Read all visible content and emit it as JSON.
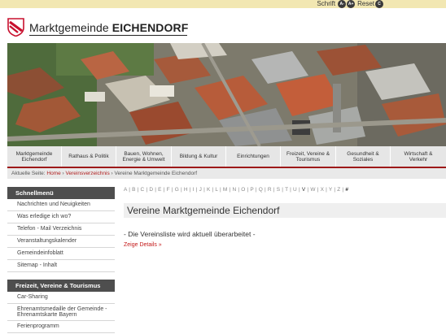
{
  "topbar": {
    "font_label": "Schrift",
    "font_decrease": "A-",
    "font_increase": "A+",
    "reset_label": "Reset",
    "reset_icon": "C"
  },
  "header": {
    "title_bold": "Marktgemeinde",
    "title_rest": "EICHENDORF"
  },
  "nav": [
    {
      "line1": "Marktgemeinde",
      "line2": "Eichendorf"
    },
    {
      "line1": "Rathaus & Politik",
      "line2": ""
    },
    {
      "line1": "Bauen, Wohnen,",
      "line2": "Energie & Umwelt"
    },
    {
      "line1": "Bildung & Kultur",
      "line2": ""
    },
    {
      "line1": "Einrichtungen",
      "line2": ""
    },
    {
      "line1": "Freizeit, Vereine &",
      "line2": "Tourismus"
    },
    {
      "line1": "Gesundheit &",
      "line2": "Soziales"
    },
    {
      "line1": "Wirtschaft &",
      "line2": "Verkehr"
    }
  ],
  "breadcrumb": {
    "prefix": "Aktuelle Seite:",
    "home": "Home",
    "sep": "›",
    "section": "Vereinsverzeichnis",
    "current": "Vereine Marktgemeinde Eichendorf"
  },
  "sidebar": {
    "quick_title": "Schnellmenü",
    "quick_items": [
      "Nachrichten und Neuigkeiten",
      "Was erledige ich wo?",
      "Telefon - Mail Verzeichnis",
      "Veranstaltungskalender",
      "Gemeindeinfoblatt",
      "Sitemap - Inhalt"
    ],
    "section_title": "Freizeit, Vereine & Tourismus",
    "section_items": [
      "Car-Sharing",
      "Ehrenamtsmedaille der Gemeinde - Ehrenamtskarte Bayern",
      "Ferienprogramm"
    ]
  },
  "alphabet": [
    "A",
    "B",
    "C",
    "D",
    "E",
    "F",
    "G",
    "H",
    "I",
    "J",
    "K",
    "L",
    "M",
    "N",
    "O",
    "P",
    "Q",
    "R",
    "S",
    "T",
    "U",
    "V",
    "W",
    "X",
    "Y",
    "Z"
  ],
  "alphabet_active": "V",
  "alphabet_hash": "#",
  "content": {
    "title": "Vereine Marktgemeinde Eichendorf",
    "notice": "- Die Vereinsliste wird aktuell überarbeitet -",
    "details_link": "Zeige Details »"
  },
  "colors": {
    "accent_red": "#b01e1e",
    "topbar": "#f2e7b2",
    "sidebar_head": "#4e4e4e"
  }
}
